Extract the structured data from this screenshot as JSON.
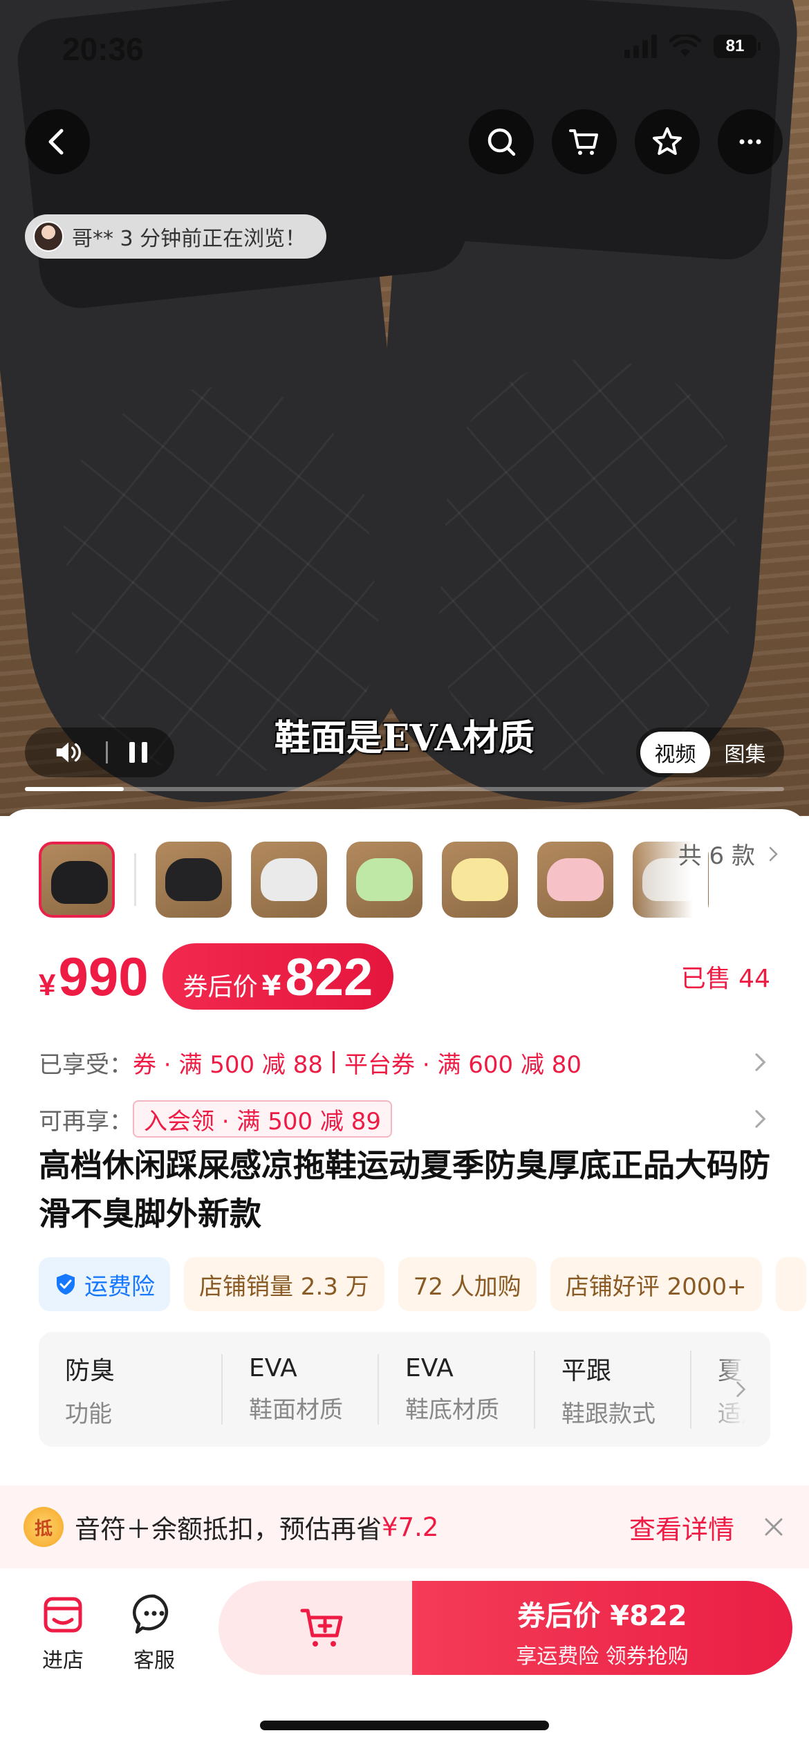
{
  "status_bar": {
    "time": "20:36",
    "battery": "81"
  },
  "top_controls": {
    "back_icon": "chevron-left-icon",
    "search_icon": "search-icon",
    "cart_icon": "cart-icon",
    "favorite_icon": "star-icon",
    "more_icon": "more-icon"
  },
  "browsing_notice": "哥** 3 分钟前正在浏览！",
  "video": {
    "subtitle": "鞋面是EVA材质",
    "progress": 0.13,
    "tabs": [
      "视频",
      "图集"
    ],
    "active_tab": 0
  },
  "variants": {
    "items": [
      {
        "color": "#1f1f21"
      },
      {
        "color": "#232325"
      },
      {
        "color": "#eaeaea"
      },
      {
        "color": "#bfe8a7"
      },
      {
        "color": "#f8e79b"
      },
      {
        "color": "#f6c1c7"
      }
    ],
    "selected": 0,
    "more_label": "共 6 款"
  },
  "price": {
    "symbol": "¥",
    "value": "990",
    "coupon_label": "券后价",
    "coupon_symbol": "¥",
    "coupon_value": "822",
    "sold": "已售 44"
  },
  "promos": {
    "enjoyed_label": "已享受：",
    "enjoyed_1": "券 · 满 500 减 88",
    "enjoyed_2": "平台券 · 满 600 减 80",
    "more_label": "可再享：",
    "more_1": "入会领 · 满 500 减 89"
  },
  "product_title": "高档休闲踩屎感凉拖鞋运动夏季防臭厚底正品大码防滑不臭脚外新款",
  "badges": {
    "shipping_insurance": "运费险",
    "items": [
      "店铺销量 2.3 万",
      "72 人加购",
      "店铺好评 2000+"
    ]
  },
  "attributes": [
    {
      "value": "防臭",
      "key": "功能"
    },
    {
      "value": "EVA",
      "key": "鞋面材质"
    },
    {
      "value": "EVA",
      "key": "鞋底材质"
    },
    {
      "value": "平跟",
      "key": "鞋跟款式"
    },
    {
      "value": "夏季",
      "key": "适用季节"
    }
  ],
  "deduction": {
    "icon_text": "抵",
    "text": "音符＋余额抵扣，预估再省",
    "amount": "¥7.2",
    "link": "查看详情"
  },
  "bottom_bar": {
    "store_label": "进店",
    "service_label": "客服",
    "buy_main": "券后价 ¥822",
    "buy_sub": "享运费险   领券抢购"
  },
  "colors": {
    "accent": "#ee1c44",
    "shipping_blue": "#1677ff"
  }
}
